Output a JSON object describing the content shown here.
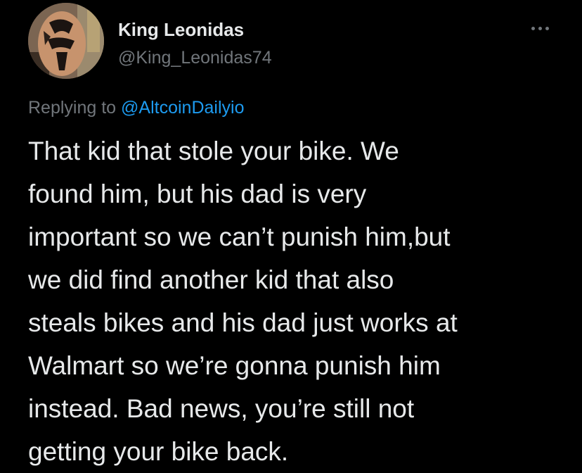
{
  "tweet": {
    "author": {
      "display_name": "King Leonidas",
      "handle": "@King_Leonidas74"
    },
    "more_icon": "more-horizontal-icon",
    "reply": {
      "prefix": "Replying to",
      "target": "@AltcoinDailyio"
    },
    "text": "That kid that stole your bike. We\nfound him, but his dad is very\nimportant so we can’t punish him,but\nwe did find another kid that also\nsteals bikes and his dad just works at\nWalmart so we’re gonna punish him\ninstead. Bad news, you’re still not\ngetting your bike back."
  },
  "colors": {
    "background": "#000000",
    "text_primary": "#e7e9ea",
    "text_secondary": "#71767b",
    "link": "#1d9bf0"
  }
}
